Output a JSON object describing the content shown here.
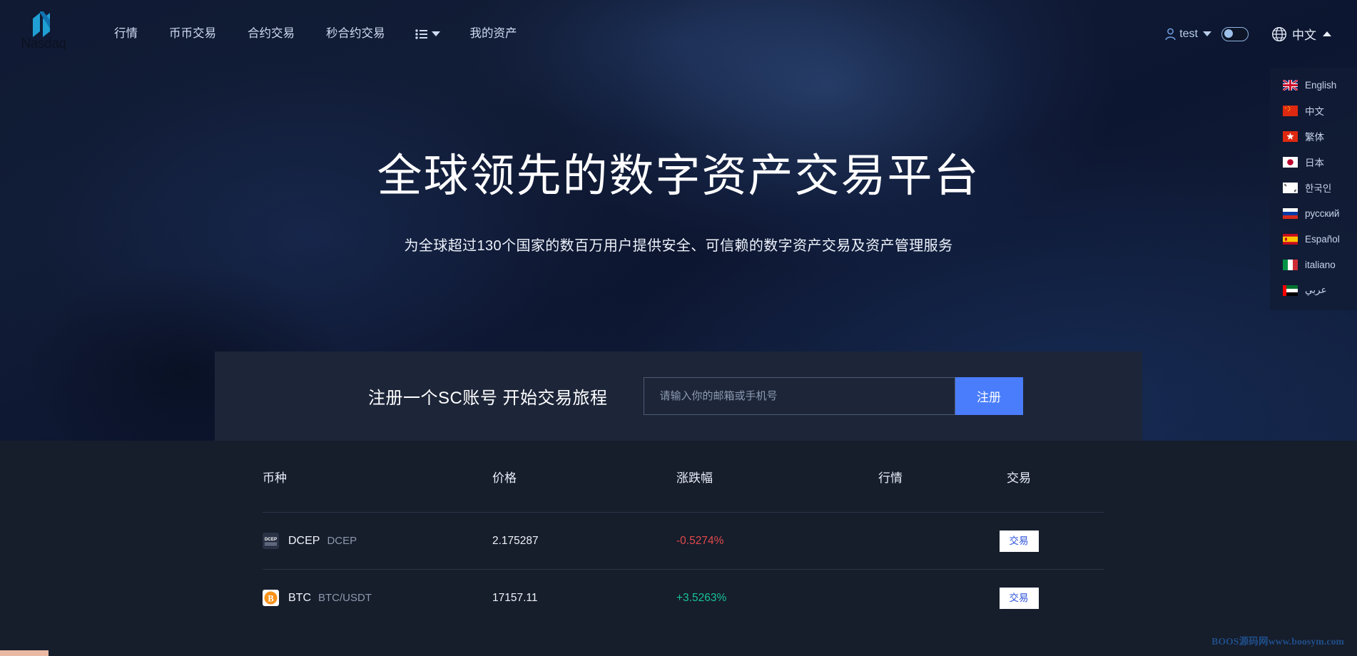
{
  "brand": {
    "logo_text": "Nasdaq",
    "logo_icon": "nasdaq-n-mark"
  },
  "nav": {
    "items": [
      {
        "label": "行情"
      },
      {
        "label": "币币交易"
      },
      {
        "label": "合约交易"
      },
      {
        "label": "秒合约交易"
      }
    ],
    "more_icon": "list-menu-icon",
    "more_caret_icon": "chevron-down-icon",
    "assets_label": "我的资产"
  },
  "account": {
    "user_icon": "person-icon",
    "username": "test",
    "caret_icon": "chevron-down-icon",
    "theme_toggle": {
      "icon": "toggle-switch-icon",
      "state": "off"
    }
  },
  "language": {
    "globe_icon": "globe-icon",
    "current": "中文",
    "caret_icon": "chevron-up-icon",
    "menu_open": true,
    "options": [
      {
        "label": "English",
        "flag": "flag-uk"
      },
      {
        "label": "中文",
        "flag": "flag-china"
      },
      {
        "label": "繁体",
        "flag": "flag-hongkong"
      },
      {
        "label": "日本",
        "flag": "flag-japan"
      },
      {
        "label": "한국인",
        "flag": "flag-korea"
      },
      {
        "label": "русский",
        "flag": "flag-russia"
      },
      {
        "label": "Español",
        "flag": "flag-spain"
      },
      {
        "label": "italiano",
        "flag": "flag-italy"
      },
      {
        "label": "عربي",
        "flag": "flag-uae"
      }
    ]
  },
  "hero": {
    "title": "全球领先的数字资产交易平台",
    "subtitle": "为全球超过130个国家的数百万用户提供安全、可信赖的数字资产交易及资产管理服务"
  },
  "register": {
    "title": "注册一个SC账号 开始交易旅程",
    "input_value": "",
    "input_placeholder": "请输入你的邮箱或手机号",
    "button_label": "注册",
    "button_color": "#4a7dfb"
  },
  "market": {
    "headers": {
      "symbol": "币种",
      "price": "价格",
      "change": "涨跌幅",
      "quote": "行情",
      "trade": "交易"
    },
    "trade_button_label": "交易",
    "colors": {
      "up": "#18c39a",
      "down": "#e24a4a"
    },
    "rows": [
      {
        "icon": "coin-icon-dcep",
        "name": "DCEP",
        "pair": "DCEP",
        "price": "2.175287",
        "change": "-0.5274%",
        "direction": "down",
        "action": "交易"
      },
      {
        "icon": "coin-icon-btc",
        "name": "BTC",
        "pair": "BTC/USDT",
        "price": "17157.11",
        "change": "+3.5263%",
        "direction": "up",
        "action": "交易"
      }
    ]
  },
  "watermark": {
    "text": "BOOS源码网www.boosym.com"
  }
}
